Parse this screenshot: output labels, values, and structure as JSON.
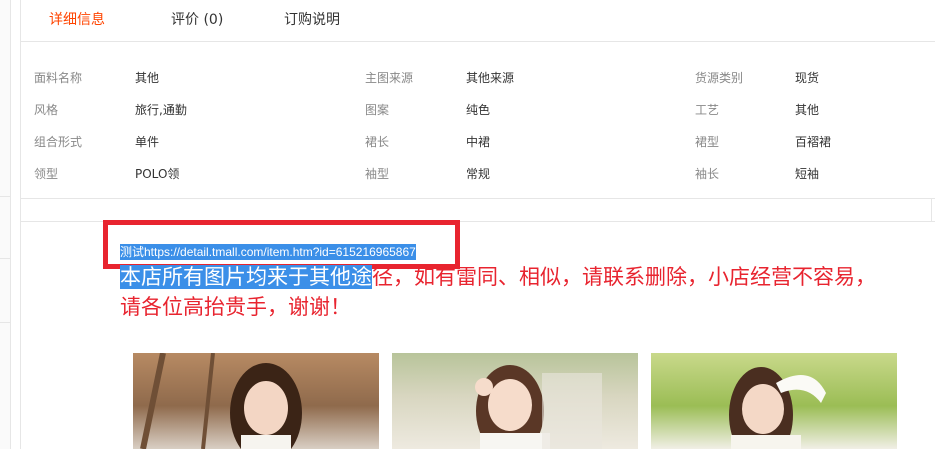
{
  "tabs": [
    {
      "label": "详细信息",
      "active": true
    },
    {
      "label": "评价 (0)",
      "active": false
    },
    {
      "label": "订购说明",
      "active": false
    }
  ],
  "attributes": [
    [
      {
        "label": "面料名称",
        "value": "其他"
      },
      {
        "label": "主图来源",
        "value": "其他来源"
      },
      {
        "label": "货源类别",
        "value": "现货"
      }
    ],
    [
      {
        "label": "风格",
        "value": "旅行,通勤"
      },
      {
        "label": "图案",
        "value": "纯色"
      },
      {
        "label": "工艺",
        "value": "其他"
      }
    ],
    [
      {
        "label": "组合形式",
        "value": "单件"
      },
      {
        "label": "裙长",
        "value": "中裙"
      },
      {
        "label": "裙型",
        "value": "百褶裙"
      }
    ],
    [
      {
        "label": "领型",
        "value": "POLO领"
      },
      {
        "label": "袖型",
        "value": "常规"
      },
      {
        "label": "袖长",
        "value": "短袖"
      }
    ]
  ],
  "description": {
    "url_text": "测试https://detail.tmall.com/item.htm?id=615216965867",
    "notice_highlighted": "本店所有图片均来于其他途",
    "notice_rest": "径，如有雷同、相似，请联系删除，小店经营不容易，请各位高抬贵手，谢谢！"
  },
  "colors": {
    "accent": "#ff4400",
    "notice_red": "#e8242f",
    "selection_blue": "#3b8fe8"
  },
  "photos": [
    {
      "name": "product-photo-1"
    },
    {
      "name": "product-photo-2"
    },
    {
      "name": "product-photo-3"
    }
  ]
}
